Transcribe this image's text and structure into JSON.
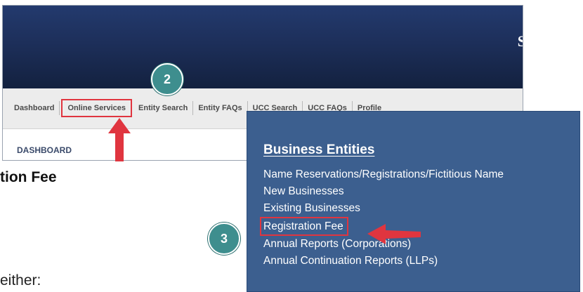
{
  "site": {
    "banner_title": "S",
    "nav_items": [
      {
        "label": "Dashboard"
      },
      {
        "label": "Online Services"
      },
      {
        "label": "Entity Search"
      },
      {
        "label": "Entity FAQs"
      },
      {
        "label": "UCC Search"
      },
      {
        "label": "UCC FAQs"
      },
      {
        "label": "Profile"
      }
    ],
    "section_label": "DASHBOARD"
  },
  "doc": {
    "heading_fragment": "tion Fee",
    "text_fragment": "either:"
  },
  "steps": {
    "step2": "2",
    "step3": "3"
  },
  "menu": {
    "heading": "Business Entities",
    "items": [
      {
        "label": "Name Reservations/Registrations/Fictitious Name"
      },
      {
        "label": "New Businesses"
      },
      {
        "label": "Existing Businesses"
      },
      {
        "label": "Registration Fee"
      },
      {
        "label": "Annual Reports (Corporations)"
      },
      {
        "label": "Annual Continuation Reports (LLPs)"
      }
    ]
  },
  "colors": {
    "banner": "#1d2f5a",
    "menu_bg": "#3c5f8f",
    "highlight": "#e0353f",
    "badge": "#3e8e8e"
  }
}
